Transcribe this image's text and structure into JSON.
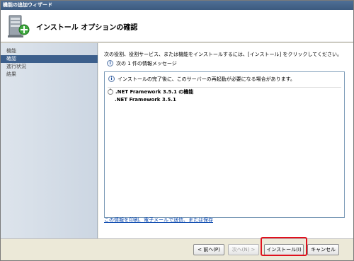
{
  "window": {
    "title": "機能の追加ウィザード"
  },
  "header": {
    "title": "インストール オプションの確認",
    "icon": "server-add-icon"
  },
  "nav": {
    "items": [
      {
        "label": "機能",
        "active": false
      },
      {
        "label": "確認",
        "active": true
      },
      {
        "label": "進行状況",
        "active": false
      },
      {
        "label": "結果",
        "active": false
      }
    ]
  },
  "content": {
    "instruction": "次の役割、役割サービス、または機能をインストールするには、[インストール] をクリックしてください。",
    "message_count": "次の 1 件の情報メッセージ",
    "list": {
      "notice": "インストールの完了後に、このサーバーの再起動が必要になる場合があります。",
      "section_title": ".NET Framework 3.5.1 の機能",
      "feature": ".NET Framework 3.5.1"
    },
    "link": "この情報を印刷、電子メールで送信、または保存"
  },
  "footer": {
    "back": "< 前へ(P)",
    "next": "次へ(N) >",
    "install": "インストール(I)",
    "cancel": "キャンセル"
  },
  "colors": {
    "highlight": "#e0101c",
    "nav_active": "#3c5f8c",
    "link": "#0645ad"
  }
}
